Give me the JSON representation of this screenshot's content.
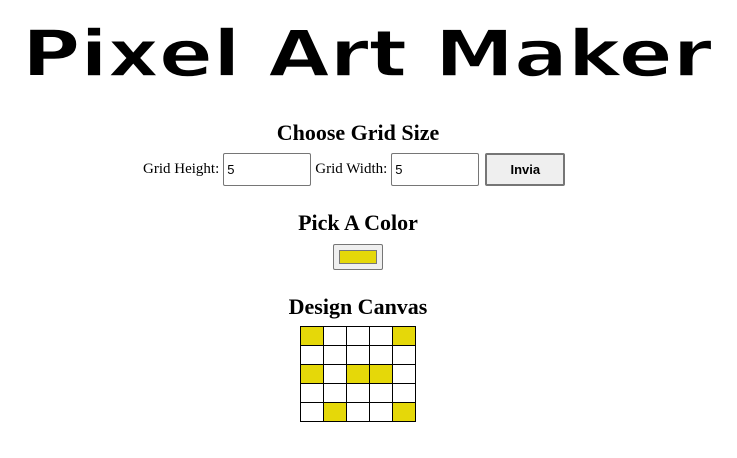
{
  "logo": {
    "text": "Pixel Art Maker"
  },
  "grid_section": {
    "heading": "Choose Grid Size",
    "height_label": "Grid Height:",
    "height_value": "5",
    "width_label": "Grid Width:",
    "width_value": "5",
    "submit_label": "Invia"
  },
  "color_section": {
    "heading": "Pick A Color",
    "selected_color": "#e5d809"
  },
  "canvas_section": {
    "heading": "Design Canvas",
    "cells": [
      [
        true,
        false,
        false,
        false,
        true
      ],
      [
        false,
        false,
        false,
        false,
        false
      ],
      [
        true,
        false,
        true,
        true,
        false
      ],
      [
        false,
        false,
        false,
        false,
        false
      ],
      [
        false,
        true,
        false,
        false,
        true
      ]
    ]
  }
}
